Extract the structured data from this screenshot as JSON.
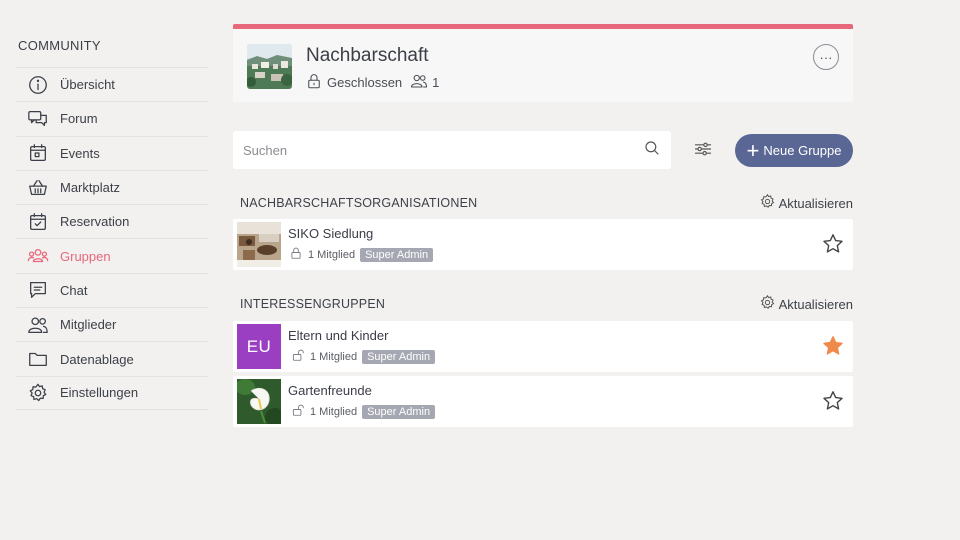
{
  "sidebar": {
    "title": "COMMUNITY",
    "items": [
      {
        "label": "Übersicht",
        "icon": "info-icon"
      },
      {
        "label": "Forum",
        "icon": "chat-bubbles-icon"
      },
      {
        "label": "Events",
        "icon": "calendar-icon"
      },
      {
        "label": "Marktplatz",
        "icon": "basket-icon"
      },
      {
        "label": "Reservation",
        "icon": "calendar-check-icon"
      },
      {
        "label": "Gruppen",
        "icon": "group-icon",
        "active": true
      },
      {
        "label": "Chat",
        "icon": "chat-icon"
      },
      {
        "label": "Mitglieder",
        "icon": "members-icon"
      },
      {
        "label": "Datenablage",
        "icon": "folder-icon"
      },
      {
        "label": "Einstellungen",
        "icon": "gear-icon"
      }
    ]
  },
  "header": {
    "title": "Nachbarschaft",
    "status": "Geschlossen",
    "members": "1",
    "more_label": "···"
  },
  "search": {
    "placeholder": "Suchen",
    "value": ""
  },
  "new_group_label": "Neue Gruppe",
  "sections": [
    {
      "title": "NACHBARSCHAFTSORGANISATIONEN",
      "refresh_label": "Aktualisieren",
      "groups": [
        {
          "name": "SIKO Siedlung",
          "members": "1 Mitglied",
          "role": "Super Admin",
          "favorite": false
        }
      ]
    },
    {
      "title": "INTERESSENGRUPPEN",
      "refresh_label": "Aktualisieren",
      "groups": [
        {
          "name": "Eltern und Kinder",
          "avatar_text": "EU",
          "members": "1 Mitglied",
          "role": "Super Admin",
          "favorite": true
        },
        {
          "name": "Gartenfreunde",
          "members": "1 Mitglied",
          "role": "Super Admin",
          "favorite": false
        }
      ]
    }
  ],
  "colors": {
    "accent": "#e8677a",
    "button": "#5a6795",
    "badge": "#a5a8b2",
    "star_active": "#f08a4b",
    "eu_avatar": "#9b3fc2"
  }
}
